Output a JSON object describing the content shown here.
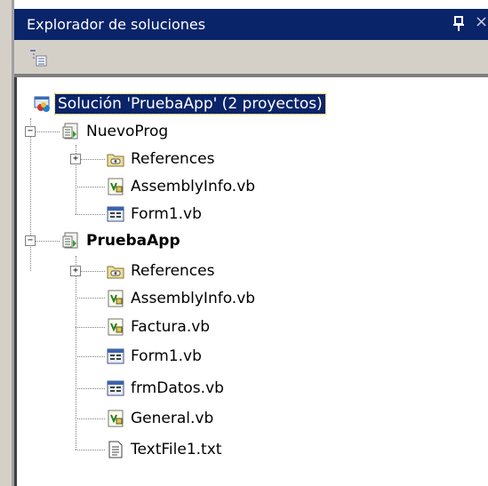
{
  "window": {
    "title": "Explorador de soluciones",
    "pin_glyph": "ᵖ",
    "close_glyph": "×"
  },
  "toolbar": {
    "buttons": [
      {
        "icon": "properties-icon"
      }
    ]
  },
  "tree": {
    "solution": {
      "label": "Solución 'PruebaApp' (2 proyectos)",
      "icon": "solution-icon",
      "selected": true
    },
    "projects": [
      {
        "label": "NuevoProg",
        "bold": false,
        "expanded": true,
        "items": [
          {
            "label": "References",
            "icon": "references-icon",
            "expandable": true
          },
          {
            "label": "AssemblyInfo.vb",
            "icon": "vb-module-icon"
          },
          {
            "label": "Form1.vb",
            "icon": "form-icon"
          }
        ]
      },
      {
        "label": "PruebaApp",
        "bold": true,
        "expanded": true,
        "items": [
          {
            "label": "References",
            "icon": "references-icon",
            "expandable": true
          },
          {
            "label": "AssemblyInfo.vb",
            "icon": "vb-module-icon"
          },
          {
            "label": "Factura.vb",
            "icon": "vb-module-icon"
          },
          {
            "label": "Form1.vb",
            "icon": "form-icon"
          },
          {
            "label": "frmDatos.vb",
            "icon": "form-icon"
          },
          {
            "label": "General.vb",
            "icon": "vb-module-icon"
          },
          {
            "label": "TextFile1.txt",
            "icon": "text-file-icon"
          }
        ]
      }
    ]
  },
  "colors": {
    "title_bg": "#0a246a",
    "toolbar_bg": "#d4d0c8",
    "selection_bg": "#0a246a"
  }
}
